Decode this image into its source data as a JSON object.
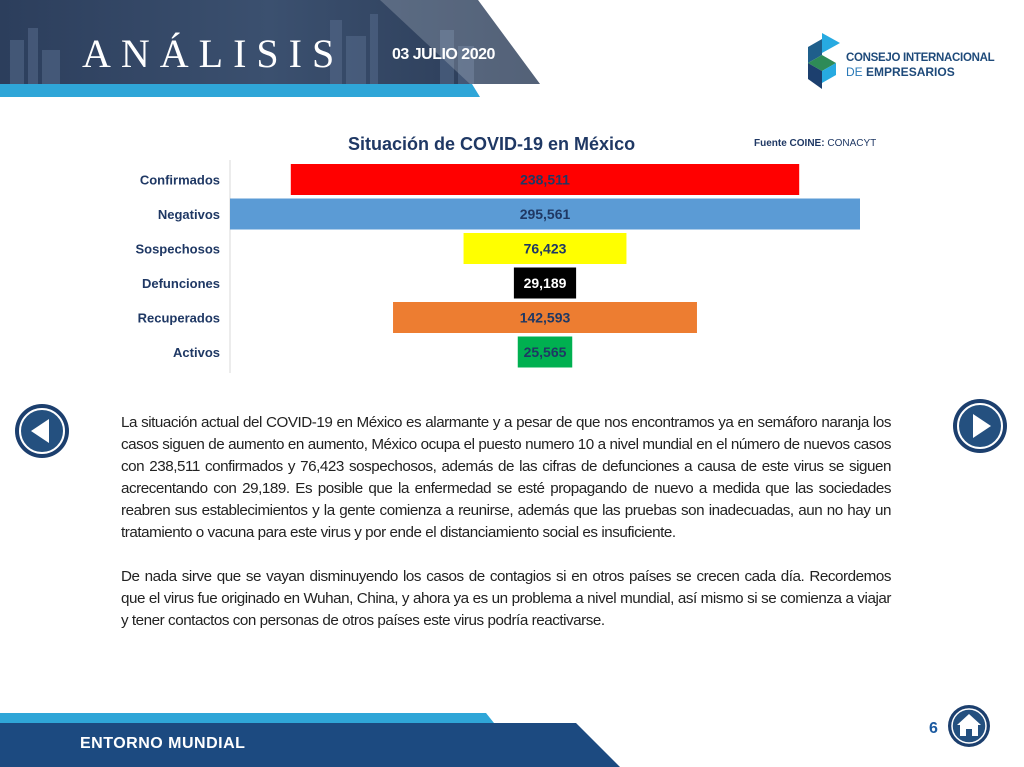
{
  "header": {
    "title": "ANÁLISIS",
    "date": "03 JULIO 2020"
  },
  "logo": {
    "line1": "CONSEJO INTERNACIONAL",
    "line2_prefix": "DE ",
    "line2_main": "EMPRESARIOS"
  },
  "chart_data": {
    "type": "bar",
    "orientation": "horizontal",
    "layout": "centered-funnel",
    "title": "Situación de COVID-19 en México",
    "source_label": "Fuente COINE:",
    "source_value": "CONACYT",
    "categories": [
      "Confirmados",
      "Negativos",
      "Sospechosos",
      "Defunciones",
      "Recuperados",
      "Activos"
    ],
    "values": [
      238511,
      295561,
      76423,
      29189,
      142593,
      25565
    ],
    "value_labels": [
      "238,511",
      "295,561",
      "76,423",
      "29,189",
      "142,593",
      "25,565"
    ],
    "colors": [
      "#ff0000",
      "#5b9bd5",
      "#ffff00",
      "#000000",
      "#ed7d31",
      "#00b050"
    ],
    "label_colors": [
      "#1f3864",
      "#1f3864",
      "#1f3864",
      "#ffffff",
      "#1f3864",
      "#1f3864"
    ],
    "grid": false,
    "legend": "none"
  },
  "body": {
    "paragraph1": "La situación actual del COVID-19 en México es alarmante y a pesar de que nos encontramos ya en semáforo naranja los casos siguen de aumento en aumento, México ocupa el  puesto numero 10 a nivel mundial en el número de nuevos casos con 238,511 confirmados y 76,423 sospechosos, además de las cifras de defunciones a causa de este virus se siguen acrecentando con 29,189. Es posible que la enfermedad se esté propagando de nuevo a medida que las sociedades reabren sus establecimientos y la gente comienza a reunirse, además que las pruebas son inadecuadas, aun no hay un tratamiento o vacuna para este virus y por ende el distanciamiento social es insuficiente.",
    "paragraph2": "De nada sirve que se vayan disminuyendo los casos de contagios si en otros países se crecen cada día. Recordemos que el virus fue originado en Wuhan, China, y ahora ya es un problema a nivel mundial, así mismo si se comienza a viajar y tener contactos con personas de otros países este virus podría reactivarse."
  },
  "navigation": {
    "prev_icon": "arrow-left-icon",
    "next_icon": "arrow-right-icon",
    "home_icon": "home-icon"
  },
  "footer": {
    "label": "ENTORNO MUNDIAL",
    "page_number": "6"
  },
  "colors": {
    "navy": "#1c3f6e",
    "accent_blue": "#2fa6d8",
    "brand_teal": "#27aae1"
  }
}
